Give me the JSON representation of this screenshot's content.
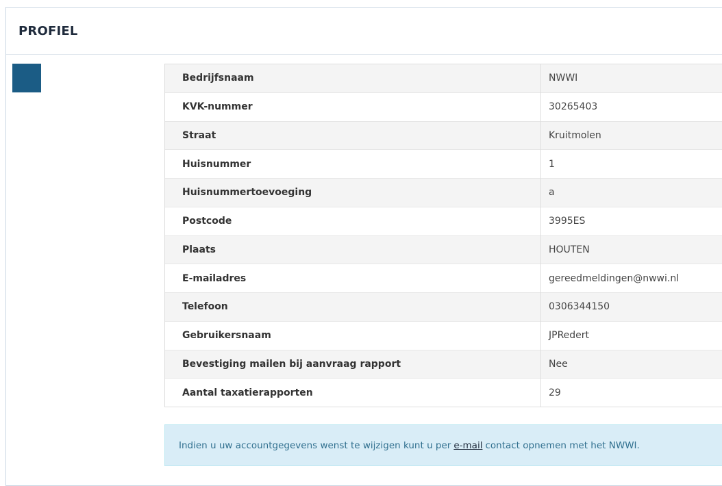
{
  "panel": {
    "title": "PROFIEL"
  },
  "profile": {
    "rows": [
      {
        "label": "Bedrijfsnaam",
        "value": "NWWI"
      },
      {
        "label": "KVK-nummer",
        "value": "30265403"
      },
      {
        "label": "Straat",
        "value": "Kruitmolen"
      },
      {
        "label": "Huisnummer",
        "value": "1"
      },
      {
        "label": "Huisnummertoevoeging",
        "value": "a"
      },
      {
        "label": "Postcode",
        "value": "3995ES"
      },
      {
        "label": "Plaats",
        "value": "HOUTEN"
      },
      {
        "label": "E-mailadres",
        "value": "gereedmeldingen@nwwi.nl"
      },
      {
        "label": "Telefoon",
        "value": "0306344150"
      },
      {
        "label": "Gebruikersnaam",
        "value": "JPRedert"
      },
      {
        "label": "Bevestiging mailen bij aanvraag rapport",
        "value": "Nee"
      },
      {
        "label": "Aantal taxatierapporten",
        "value": "29"
      }
    ]
  },
  "info": {
    "text_before": "Indien u uw accountgegevens wenst te wijzigen kunt u per",
    "link": "e-mail",
    "text_after": "contact opnemen met het NWWI."
  },
  "colors": {
    "accent": "#1b5c85",
    "alert_bg": "#d9edf7",
    "alert_text": "#31708f"
  }
}
